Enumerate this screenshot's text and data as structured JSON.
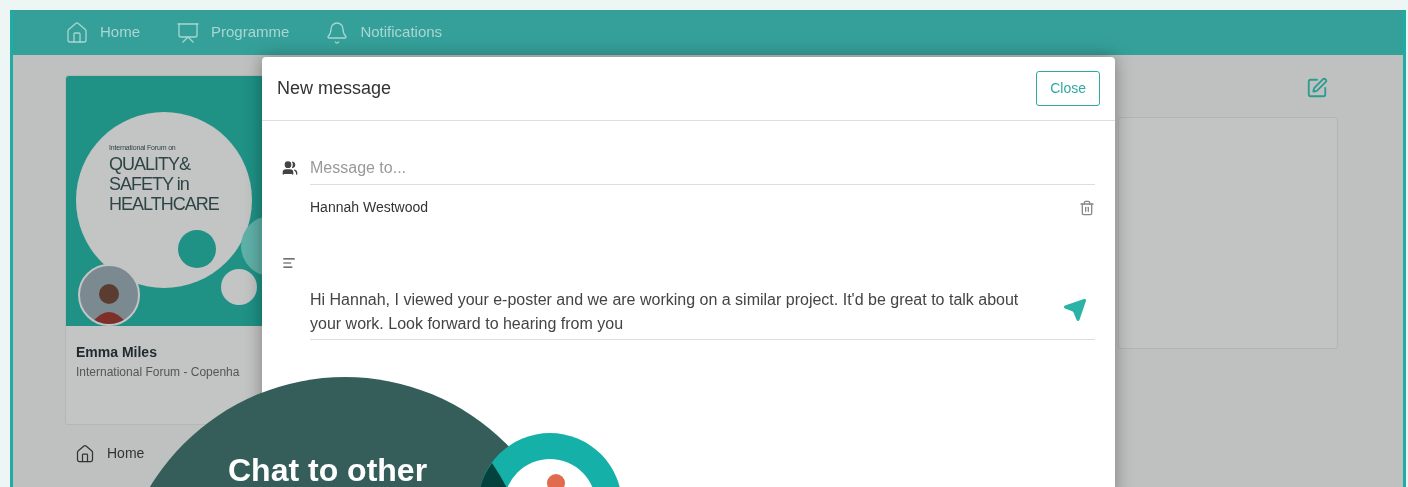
{
  "nav": {
    "items": [
      {
        "kind": "home",
        "label": "Home"
      },
      {
        "kind": "programme",
        "label": "Programme"
      },
      {
        "kind": "notifications",
        "label": "Notifications"
      }
    ]
  },
  "profile": {
    "banner": {
      "kicker": "International Forum on",
      "lines": [
        "QUALITY&",
        "SAFETY in",
        "HEALTHCARE"
      ]
    },
    "name": "Emma Miles",
    "subtitle": "International Forum - Copenha"
  },
  "side_nav": [
    {
      "kind": "home",
      "label": "Home"
    }
  ],
  "modal": {
    "title": "New message",
    "close": "Close",
    "recipient_field": {
      "placeholder": "Message to..."
    },
    "recipients": [
      "Hannah Westwood"
    ],
    "message": {
      "value": "Hi Hannah, I viewed your e-poster and we are working on a similar project. It'd be great to talk about your work. Look forward to hearing from you"
    }
  },
  "promo": {
    "headline": "Chat to other"
  }
}
